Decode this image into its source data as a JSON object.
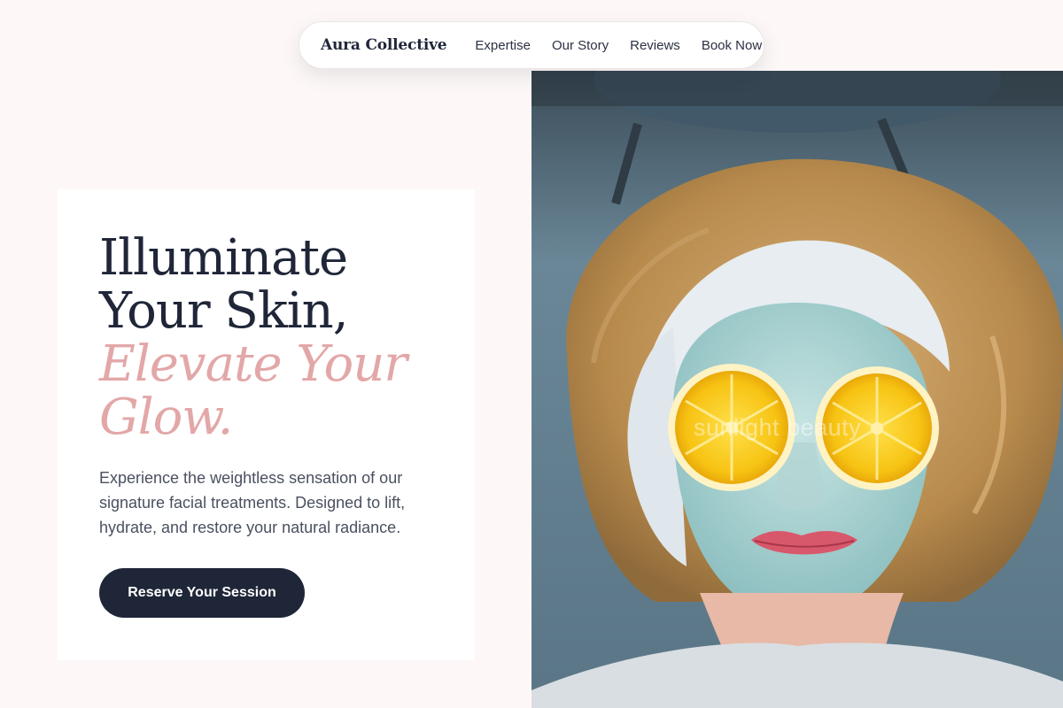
{
  "nav": {
    "brand": "Aura Collective",
    "links": [
      "Expertise",
      "Our Story",
      "Reviews",
      "Book Now"
    ]
  },
  "hero": {
    "headline_line1": "Illuminate",
    "headline_line2": "Your Skin,",
    "headline_accent1": "Elevate Your",
    "headline_accent2": "Glow.",
    "description": "Experience the weightless sensation of our signature facial treatments. Designed to lift, hydrate, and restore your natural radiance.",
    "cta_label": "Reserve Your Session"
  },
  "photo": {
    "watermark": "sunlight beauty"
  },
  "colors": {
    "background": "#fdf8f7",
    "navy": "#1f2638",
    "accent_pink": "#e3a7a8",
    "body_text": "#4a5060"
  }
}
